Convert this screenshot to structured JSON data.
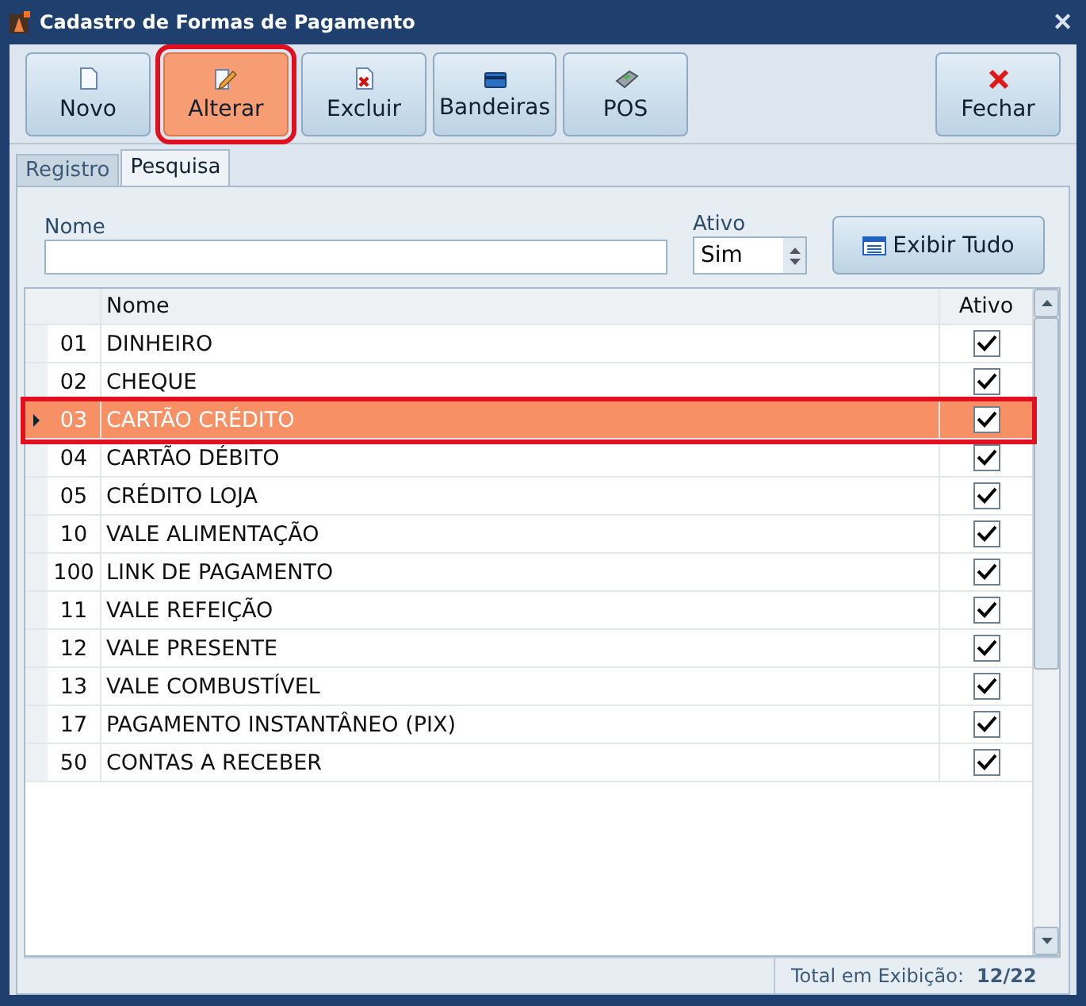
{
  "window": {
    "title": "Cadastro de Formas de Pagamento",
    "close": "✕"
  },
  "toolbar": [
    {
      "label": "Novo",
      "kind": "new",
      "highlighted": false
    },
    {
      "label": "Alterar",
      "kind": "edit",
      "highlighted": true
    },
    {
      "label": "Excluir",
      "kind": "delete",
      "highlighted": false
    },
    {
      "label": "Bandeiras",
      "kind": "cards",
      "highlighted": false
    },
    {
      "label": "POS",
      "kind": "pos",
      "highlighted": false
    },
    {
      "label": "Fechar",
      "kind": "close",
      "highlighted": false
    }
  ],
  "tabs": [
    {
      "label": "Registro",
      "selected": false
    },
    {
      "label": "Pesquisa",
      "selected": true
    }
  ],
  "filters": {
    "nome_label": "Nome",
    "ativo_label": "Ativo",
    "ativo_value": "Sim",
    "show_all": "Exibir Tudo"
  },
  "table": {
    "columns": [
      "Nome",
      "Ativo"
    ],
    "rows": [
      {
        "code": "01",
        "name": "DINHEIRO",
        "checked": true,
        "selected": false,
        "highlighted": false
      },
      {
        "code": "02",
        "name": "CHEQUE",
        "checked": true,
        "selected": false,
        "highlighted": false
      },
      {
        "code": "03",
        "name": "CARTÃO CRÉDITO",
        "checked": true,
        "selected": true,
        "highlighted": true
      },
      {
        "code": "04",
        "name": "CARTÃO DÉBITO",
        "checked": true,
        "selected": false,
        "highlighted": false
      },
      {
        "code": "05",
        "name": "CRÉDITO LOJA",
        "checked": true,
        "selected": false,
        "highlighted": false
      },
      {
        "code": "10",
        "name": "VALE ALIMENTAÇÃO",
        "checked": true,
        "selected": false,
        "highlighted": false
      },
      {
        "code": "100",
        "name": "LINK DE PAGAMENTO",
        "checked": true,
        "selected": false,
        "highlighted": false
      },
      {
        "code": "11",
        "name": "VALE REFEIÇÃO",
        "checked": true,
        "selected": false,
        "highlighted": false
      },
      {
        "code": "12",
        "name": "VALE PRESENTE",
        "checked": true,
        "selected": false,
        "highlighted": false
      },
      {
        "code": "13",
        "name": "VALE COMBUSTÍVEL",
        "checked": true,
        "selected": false,
        "highlighted": false
      },
      {
        "code": "17",
        "name": "PAGAMENTO INSTANTÂNEO (PIX)",
        "checked": true,
        "selected": false,
        "highlighted": false
      },
      {
        "code": "50",
        "name": "CONTAS A RECEBER",
        "checked": true,
        "selected": false,
        "highlighted": false
      }
    ]
  },
  "status_bar": {
    "label": "Total em Exibição:",
    "value": "12/22"
  }
}
